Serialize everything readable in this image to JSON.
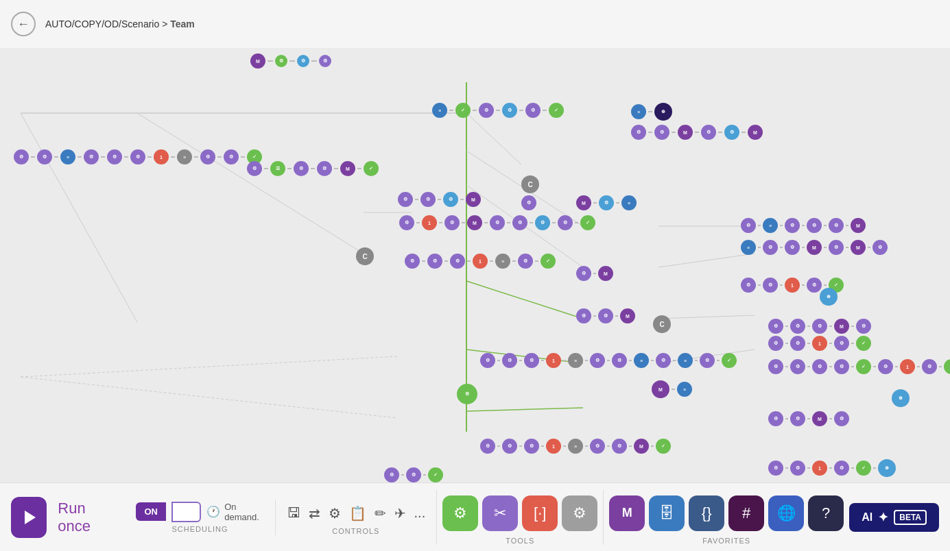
{
  "header": {
    "back_label": "←",
    "breadcrumb": "AUTO/COPY/OD/Scenario",
    "separator": ">",
    "location": "Team"
  },
  "bottom": {
    "run_once_label": "Run once",
    "on_label": "ON",
    "on_demand_label": "On demand.",
    "scheduling_label": "SCHEDULING",
    "controls_label": "CONTROLS",
    "tools_label": "TOOLS",
    "favorites_label": "FAVORITES",
    "ai_label": "AI",
    "beta_label": "BETA",
    "more_label": "..."
  },
  "canvas": {
    "description": "Workflow automation canvas with many connected nodes"
  }
}
